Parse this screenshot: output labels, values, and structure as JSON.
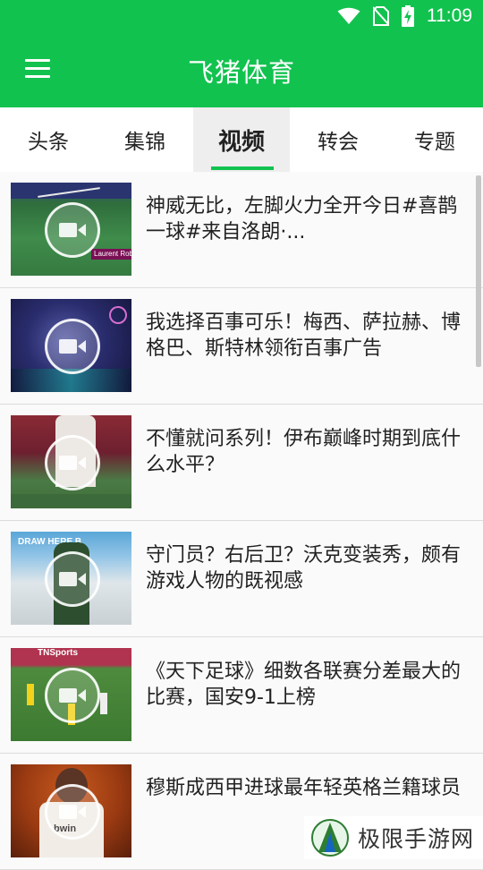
{
  "status_bar": {
    "time": "11:09"
  },
  "app_bar": {
    "title": "飞猪体育"
  },
  "tabs": [
    {
      "label": "头条",
      "active": false
    },
    {
      "label": "集锦",
      "active": false
    },
    {
      "label": "视频",
      "active": true
    },
    {
      "label": "转会",
      "active": false
    },
    {
      "label": "专题",
      "active": false
    }
  ],
  "videos": [
    {
      "title": "神威无比，左脚火力全开今日#喜鹊一球#来自洛朗·...",
      "thumb_text": "Laurent Rob"
    },
    {
      "title": "我选择百事可乐！梅西、萨拉赫、博格巴、斯特林领衔百事广告"
    },
    {
      "title": "不懂就问系列！伊布巅峰时期到底什么水平？"
    },
    {
      "title": "守门员？右后卫？沃克变装秀，颇有游戏人物的既视感",
      "thumb_text": "DRAW HERE B"
    },
    {
      "title": "《天下足球》细数各联赛分差最大的比赛，国安9-1上榜",
      "thumb_text": "TNSports"
    },
    {
      "title": "穆斯成西甲进球最年轻英格兰籍球员",
      "thumb_text": "bwin"
    }
  ],
  "watermark": {
    "text": "极限手游网"
  },
  "colors": {
    "primary": "#12c24f",
    "text": "#222222",
    "divider": "#dcdcdc"
  },
  "icons": [
    "wifi-icon",
    "no-sim-icon",
    "battery-charging-icon",
    "menu-icon",
    "video-camera-icon"
  ]
}
